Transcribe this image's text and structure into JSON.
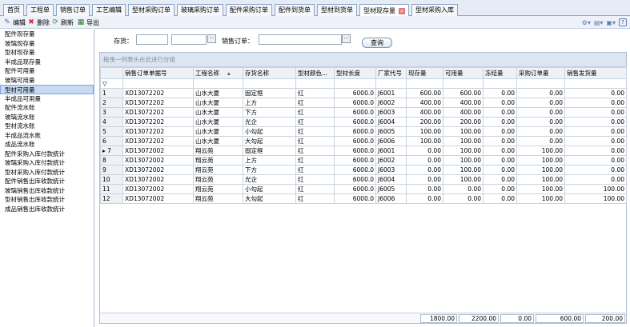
{
  "tabs": [
    {
      "label": "首页"
    },
    {
      "label": "工程单"
    },
    {
      "label": "销售订单"
    },
    {
      "label": "工艺编辑"
    },
    {
      "label": "型材采购订单"
    },
    {
      "label": "玻璃采购订单"
    },
    {
      "label": "配件采购订单"
    },
    {
      "label": "配件到货单"
    },
    {
      "label": "型材到货单"
    },
    {
      "label": "型材现存量",
      "active": true
    },
    {
      "label": "型材采购入库"
    }
  ],
  "toolbar": {
    "edit": "编辑",
    "delete": "删除",
    "refresh": "刷新",
    "export": "导出"
  },
  "sidebar": [
    "配件现存量",
    "玻璃现存量",
    "型材现存量",
    "半成品现存量",
    "配件可用量",
    "玻璃可用量",
    "型材可用量",
    "半成品可用量",
    "配件流水账",
    "玻璃流水账",
    "型材流水账",
    "半成品流水账",
    "成品流水账",
    "配件采购入库付款统计",
    "玻璃采购入库付款统计",
    "型材采购入库付款统计",
    "配件销售出库收款统计",
    "玻璃销售出库收款统计",
    "型材销售出库收款统计",
    "成品销售出库收款统计"
  ],
  "sidebar_active": 6,
  "search": {
    "stock_label": "存货：",
    "order_label": "销售订单：",
    "query_label": "查询"
  },
  "grid": {
    "group_hint": "拖曳一列表头在此进行分组",
    "filter_icon": "▽",
    "columns": [
      "销售订单单据号",
      "工程名称",
      "存货名称",
      "型材颜色...",
      "型材长度",
      "厂家代号",
      "现存量",
      "可用量",
      "冻结量",
      "采购订单量",
      "销售发货量"
    ],
    "sort_marker": "▴",
    "rows": [
      [
        "1",
        "XD13072202",
        "山水大厦",
        "固定框",
        "红",
        "6000.0",
        "J6001",
        "600.00",
        "600.00",
        "0.00",
        "0.00",
        "0.00"
      ],
      [
        "2",
        "XD13072202",
        "山水大厦",
        "上方",
        "红",
        "6000.0",
        "J6002",
        "400.00",
        "400.00",
        "0.00",
        "0.00",
        "0.00"
      ],
      [
        "3",
        "XD13072202",
        "山水大厦",
        "下方",
        "红",
        "6000.0",
        "J6003",
        "400.00",
        "400.00",
        "0.00",
        "0.00",
        "0.00"
      ],
      [
        "4",
        "XD13072202",
        "山水大厦",
        "光企",
        "红",
        "6000.0",
        "J6004",
        "200.00",
        "200.00",
        "0.00",
        "0.00",
        "0.00"
      ],
      [
        "5",
        "XD13072202",
        "山水大厦",
        "小勾起",
        "红",
        "6000.0",
        "J6005",
        "100.00",
        "100.00",
        "0.00",
        "0.00",
        "0.00"
      ],
      [
        "6",
        "XD13072202",
        "山水大厦",
        "大勾起",
        "红",
        "6000.0",
        "J6006",
        "100.00",
        "100.00",
        "0.00",
        "0.00",
        "0.00"
      ],
      [
        "▸ 7",
        "XD13072002",
        "翔云苑",
        "固定框",
        "红",
        "6000.0",
        "J6001",
        "0.00",
        "100.00",
        "0.00",
        "100.00",
        "0.00"
      ],
      [
        "8",
        "XD13072002",
        "翔云苑",
        "上方",
        "红",
        "6000.0",
        "J6002",
        "0.00",
        "100.00",
        "0.00",
        "100.00",
        "0.00"
      ],
      [
        "9",
        "XD13072002",
        "翔云苑",
        "下方",
        "红",
        "6000.0",
        "J6003",
        "0.00",
        "100.00",
        "0.00",
        "100.00",
        "0.00"
      ],
      [
        "10",
        "XD13072002",
        "翔云苑",
        "光企",
        "红",
        "6000.0",
        "J6004",
        "0.00",
        "100.00",
        "0.00",
        "100.00",
        "0.00"
      ],
      [
        "11",
        "XD13072002",
        "翔云苑",
        "小勾起",
        "红",
        "6000.0",
        "J6005",
        "0.00",
        "0.00",
        "0.00",
        "100.00",
        "100.00"
      ],
      [
        "12",
        "XD13072002",
        "翔云苑",
        "大勾起",
        "红",
        "6000.0",
        "J6006",
        "0.00",
        "0.00",
        "0.00",
        "100.00",
        "100.00"
      ]
    ],
    "totals": [
      "1800.00",
      "2200.00",
      "0.00",
      "600.00",
      "200.00"
    ]
  }
}
